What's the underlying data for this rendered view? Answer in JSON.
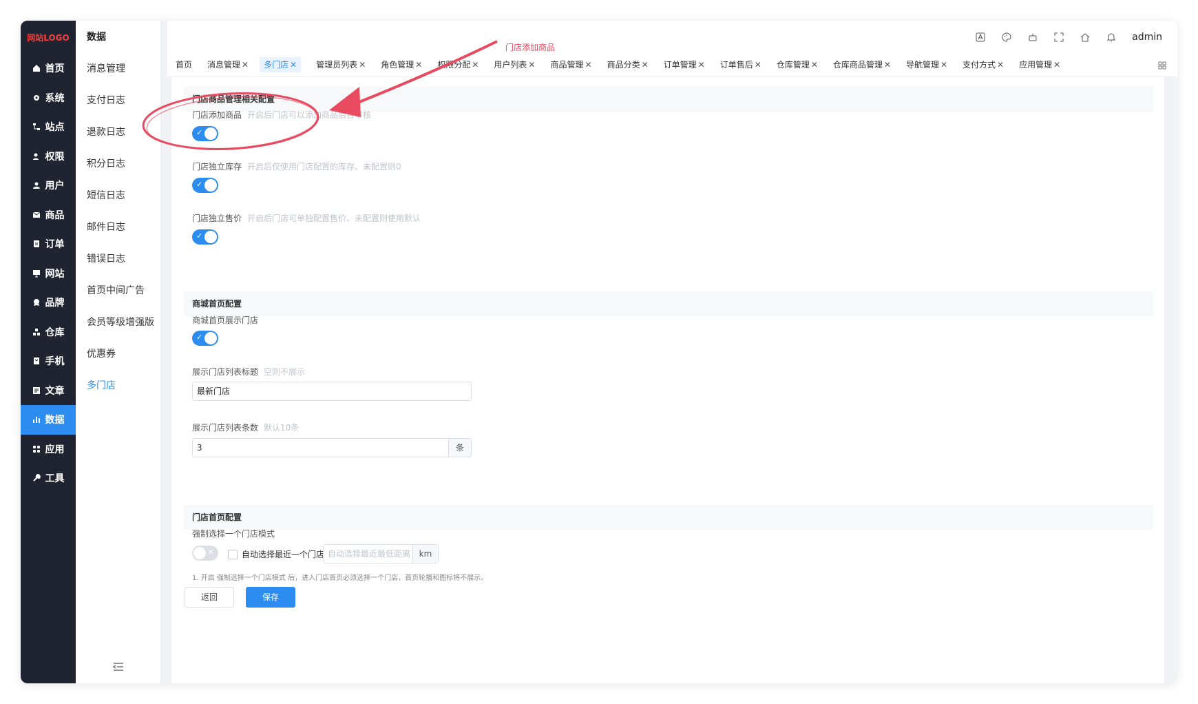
{
  "logo": "网站LOGO",
  "rail": [
    {
      "label": "首页",
      "icon": "home-icon"
    },
    {
      "label": "系统",
      "icon": "gear-icon"
    },
    {
      "label": "站点",
      "icon": "sitemap-icon"
    },
    {
      "label": "权限",
      "icon": "user-key-icon"
    },
    {
      "label": "用户",
      "icon": "user-icon"
    },
    {
      "label": "商品",
      "icon": "envelope-icon"
    },
    {
      "label": "订单",
      "icon": "clipboard-icon"
    },
    {
      "label": "网站",
      "icon": "monitor-icon"
    },
    {
      "label": "品牌",
      "icon": "badge-icon"
    },
    {
      "label": "仓库",
      "icon": "boxes-icon"
    },
    {
      "label": "手机",
      "icon": "phone-icon"
    },
    {
      "label": "文章",
      "icon": "article-icon"
    },
    {
      "label": "数据",
      "icon": "bar-chart-icon"
    },
    {
      "label": "应用",
      "icon": "grid-icon"
    },
    {
      "label": "工具",
      "icon": "wrench-icon"
    }
  ],
  "submenu": {
    "title": "数据",
    "items": [
      "消息管理",
      "支付日志",
      "退款日志",
      "积分日志",
      "短信日志",
      "邮件日志",
      "错误日志",
      "首页中间广告",
      "会员等级增强版",
      "优惠券",
      "多门店"
    ]
  },
  "topbar": {
    "user": "admin"
  },
  "tabs": [
    {
      "label": "首页",
      "closable": false
    },
    {
      "label": "消息管理",
      "closable": true
    },
    {
      "label": "多门店",
      "closable": true
    },
    {
      "label": "管理员列表",
      "closable": true
    },
    {
      "label": "角色管理",
      "closable": true
    },
    {
      "label": "权限分配",
      "closable": true
    },
    {
      "label": "用户列表",
      "closable": true
    },
    {
      "label": "商品管理",
      "closable": true
    },
    {
      "label": "商品分类",
      "closable": true
    },
    {
      "label": "订单管理",
      "closable": true
    },
    {
      "label": "订单售后",
      "closable": true
    },
    {
      "label": "仓库管理",
      "closable": true
    },
    {
      "label": "仓库商品管理",
      "closable": true
    },
    {
      "label": "导航管理",
      "closable": true
    },
    {
      "label": "支付方式",
      "closable": true
    },
    {
      "label": "应用管理",
      "closable": true
    }
  ],
  "sections": {
    "store_goods": {
      "title": "门店商品管理相关配置",
      "add_goods": {
        "label": "门店添加商品",
        "hint": "开启后门店可以添加商品后台审核",
        "on": true
      },
      "independent_stock": {
        "label": "门店独立库存",
        "hint": "开启后仅使用门店配置的库存、未配置则0",
        "on": true
      },
      "independent_price": {
        "label": "门店独立售价",
        "hint": "开启后门店可单独配置售价、未配置则使用默认",
        "on": true
      }
    },
    "mall_home": {
      "title": "商城首页配置",
      "show_store": {
        "label": "商城首页展示门店",
        "on": true
      },
      "list_title": {
        "label": "展示门店列表标题",
        "hint": "空则不展示",
        "value": "最新门店"
      },
      "list_count": {
        "label": "展示门店列表条数",
        "hint": "默认10条",
        "value": "3",
        "suffix": "条"
      }
    },
    "store_home": {
      "title": "门店首页配置",
      "force_select": {
        "label": "强制选择一个门店模式",
        "on": false
      },
      "auto_nearest": "自动选择最近一个门店",
      "min_distance_placeholder": "自动选择最近最低距离",
      "distance_unit": "km",
      "note": "1. 开启 强制选择一个门店模式 后，进入门店首页必须选择一个门店，首页轮播和图标将不展示。"
    }
  },
  "buttons": {
    "back": "返回",
    "save": "保存"
  },
  "annotation": {
    "text": "门店添加商品",
    "color": "#e84a5f"
  },
  "colors": {
    "primary": "#2d8cf0",
    "rail_bg": "#1f2430",
    "logo": "#ff3b3b"
  }
}
